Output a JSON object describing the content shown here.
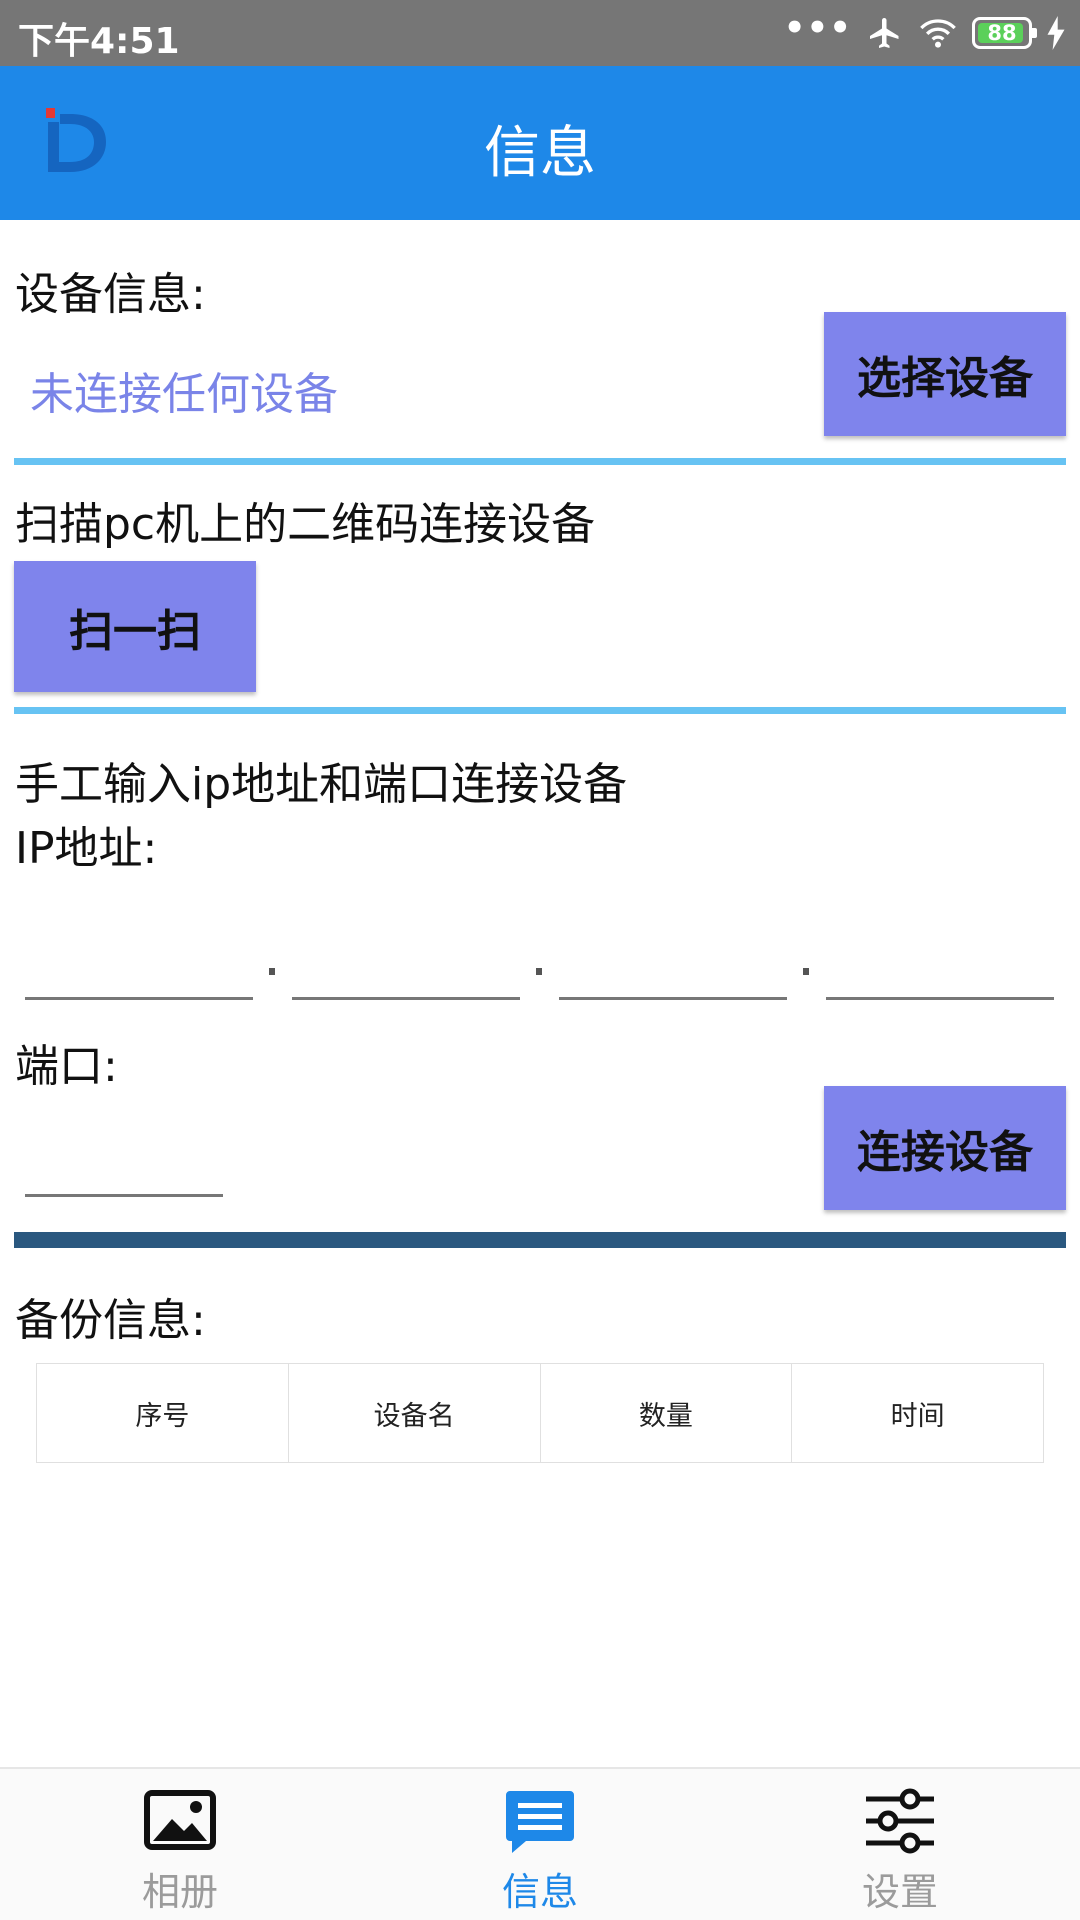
{
  "status_bar": {
    "time": "下午4:51",
    "dots": "•••",
    "battery": "88"
  },
  "app_bar": {
    "title": "信息",
    "logo_icon": "d-logo-icon"
  },
  "device_info": {
    "label": "设备信息:",
    "status": "未连接任何设备",
    "select_button": "选择设备"
  },
  "scan": {
    "label": "扫描pc机上的二维码连接设备",
    "button": "扫一扫"
  },
  "manual": {
    "label": "手工输入ip地址和端口连接设备",
    "ip_label": "IP地址:",
    "ip_parts": [
      "",
      "",
      "",
      ""
    ],
    "port_label": "端口:",
    "port_value": "",
    "connect_button": "连接设备"
  },
  "backup": {
    "label": "备份信息:",
    "columns": [
      "序号",
      "设备名",
      "数量",
      "时间"
    ]
  },
  "bottom_nav": {
    "items": [
      {
        "label": "相册",
        "icon": "image-icon",
        "active": false
      },
      {
        "label": "信息",
        "icon": "message-icon",
        "active": true
      },
      {
        "label": "设置",
        "icon": "sliders-icon",
        "active": false
      }
    ]
  },
  "colors": {
    "primary": "#1e88e8",
    "button": "#7f84ec",
    "divider": "#67c3f3",
    "divider_dark": "#2a587f",
    "status_text": "#7a84e8"
  }
}
